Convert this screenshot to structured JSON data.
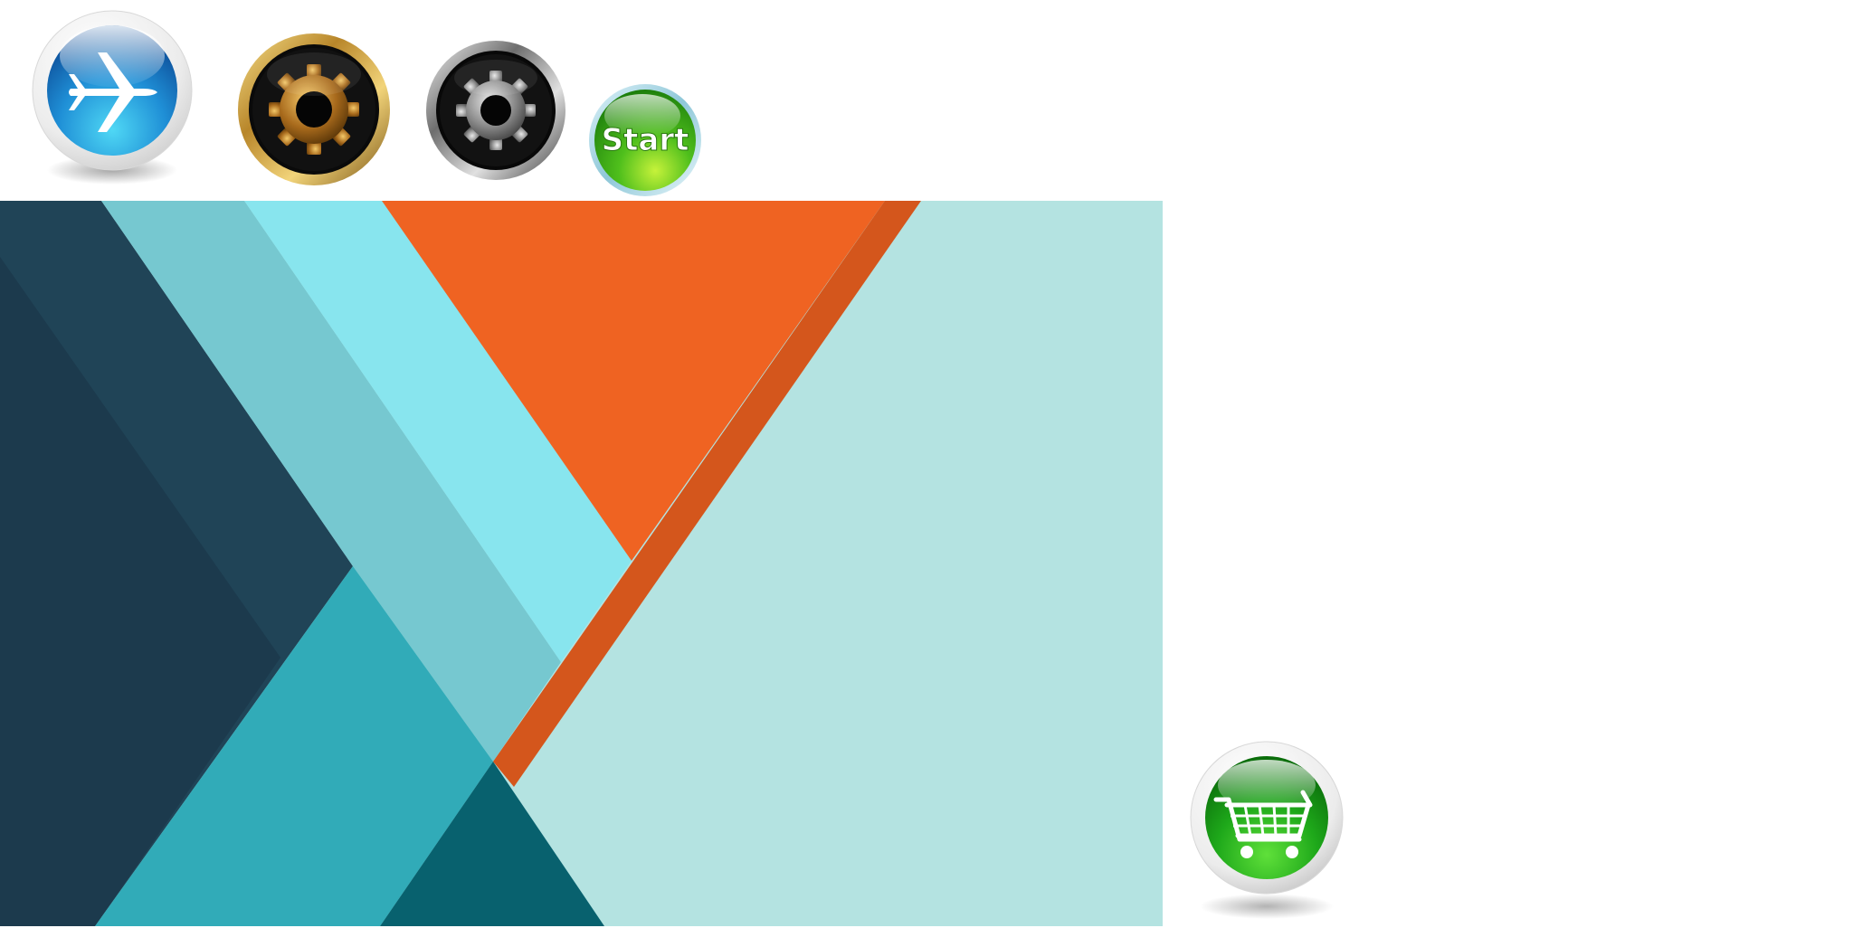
{
  "desktop": {
    "icons": [
      {
        "id": "airplane",
        "icon": "airplane-icon",
        "color": "#2fa9e6"
      },
      {
        "id": "gold-gear",
        "icon": "gear-icon",
        "color": "#c9962c"
      },
      {
        "id": "silver-gear",
        "icon": "gear-icon",
        "color": "#9a9a9a"
      },
      {
        "id": "start",
        "label": "Start",
        "color": "#3aa61a"
      },
      {
        "id": "cart",
        "icon": "shopping-cart-icon",
        "color": "#22a020"
      }
    ]
  },
  "wallpaper": {
    "style": "material-geometric",
    "colors": {
      "dark_navy": "#1c3a4d",
      "navy": "#204457",
      "teal_light": "#76c8d0",
      "cyan": "#88e5ee",
      "orange": "#ef6322",
      "orange_dark": "#d4561c",
      "mint": "#b4e3e1",
      "teal": "#31abb8",
      "deep_teal": "#08616e"
    }
  }
}
